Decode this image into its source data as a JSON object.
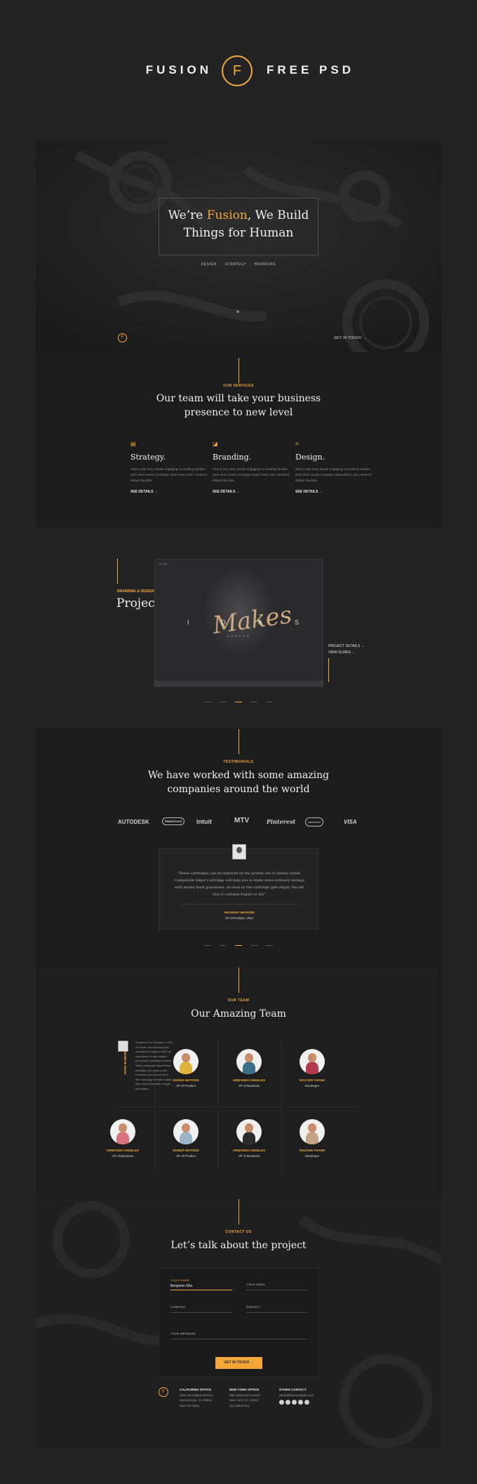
{
  "brand": {
    "left": "FUSION",
    "logo": "F",
    "right": "FREE PSD"
  },
  "hero": {
    "title_pre": "We’re ",
    "title_accent": "Fusion",
    "title_post": ", We Build",
    "title_line2": "Things for Human",
    "tags": [
      "DESIGN",
      "STRATEGY",
      "BRANDING"
    ],
    "logo": "F",
    "cta": "GET IN TOUCH →"
  },
  "services": {
    "kicker": "OUR SERVICES",
    "title_line1": "Our team will take your business",
    "title_line2": "presence to new level",
    "items": [
      {
        "icon": "strategy-icon",
        "title": "Strategy.",
        "text": "Strip it user story iterate engaging co-working intuitive pitch deck hacker prototype SpaceTeam user centered design big data.",
        "link": "SEE DETAILS →"
      },
      {
        "icon": "branding-icon",
        "title": "Branding.",
        "text": "Strip it user story iterate engaging co-working intuitive pitch deck hacker prototype SpaceTeam user centered design big data.",
        "link": "SEE DETAILS →"
      },
      {
        "icon": "design-icon",
        "title": "Design.",
        "text": "Strip it user story iterate engaging co-working intuitive pitch deck hacker prototype SpaceTeam user centered design big data.",
        "link": "SEE DETAILS →"
      }
    ]
  },
  "project": {
    "kicker": "BRANDING & DESIGN",
    "title": "Project One",
    "image_letters": "IDAS",
    "image_script": "Makes",
    "image_sub": "DEFFER",
    "image_topbar": "OCTA",
    "links": [
      "PROJECT DETAILS →",
      "VIEW SLIDES →"
    ]
  },
  "testimonials": {
    "kicker": "TESTIMONIALS",
    "title_line1": "We have worked with some amazing",
    "title_line2": "companies around the world",
    "logos": [
      "AUTODESK",
      "Mastercard",
      "intuit",
      "MTV",
      "Pinterest",
      "salesforce",
      "VISA"
    ],
    "quote": "\"These cartridges can be replaced by the printer ink of similar brand. Compatible Inkjet Cartridge will help you to make extra-ordinary savings with money back guarantee. As soon as the cartridge gets empty the ink that it contains begins to dry\"",
    "name": "ANTHONY WATKINS",
    "role": "VP of Product, VISA"
  },
  "team": {
    "kicker": "OUR TEAM",
    "title": "Our Amazing Team",
    "founder_name": "MARY BARKER",
    "founder_text": "Vincent is the Founder & CEO of Fusion. He is leading the company to success with his experience & well crafted processes paradigm solution. Strip it integrate SpaceTeam paradigm personas guide. Paradise food crunch fund 360 campaign venture capital pitch deck actionable insight innovation.",
    "members": [
      {
        "name": "DONNA WATSON",
        "role": "VP of Product"
      },
      {
        "name": "ARMANDO ANGELES",
        "role": "VP of Business"
      },
      {
        "name": "NGUYEN THANH",
        "role": "Developer"
      },
      {
        "name": "ARMANDO ANGELES",
        "role": "VP of Business"
      },
      {
        "name": "DONNA WATSON",
        "role": "VP of Product"
      },
      {
        "name": "ARMANDO ANGELES",
        "role": "VP of Business"
      },
      {
        "name": "NGUYEN THANH",
        "role": "Developer"
      }
    ]
  },
  "contact": {
    "kicker": "CONTACT US",
    "title": "Let’s talk about the project",
    "form": {
      "name_label": "YOUR NAME",
      "name_value": "Benjamin Sha",
      "email_label": "YOUR EMAIL",
      "company_label": "COMPANY",
      "subject_label": "SUBJECT",
      "message_label": "YOUR MESSAGE",
      "submit": "GET IN TOUCH →"
    },
    "footer_logo": "F",
    "offices": [
      {
        "heading": "CALIFORNIA OFFICE",
        "lines": [
          "4243 Woodland Terrace",
          "Sacramento, CA 95814",
          "916-722-3646"
        ]
      },
      {
        "heading": "NEW YORK OFFICE",
        "lines": [
          "882 Oakwood Avenue",
          "New York, NY 10013",
          "212-646-5744"
        ]
      }
    ],
    "other": {
      "heading": "OTHER CONTACT",
      "email": "jakob@fusionstudio.com",
      "socials": [
        "facebook-icon",
        "twitter-icon",
        "dribbble-icon",
        "behance-icon",
        "instagram-icon"
      ]
    }
  },
  "colors": {
    "accent": "#f5a83a",
    "background": "#232323",
    "panel": "#1c1c1c"
  }
}
